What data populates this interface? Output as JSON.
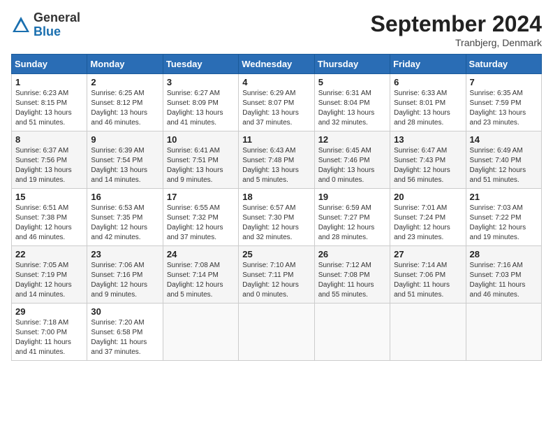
{
  "header": {
    "logo_general": "General",
    "logo_blue": "Blue",
    "title": "September 2024",
    "location": "Tranbjerg, Denmark"
  },
  "days_of_week": [
    "Sunday",
    "Monday",
    "Tuesday",
    "Wednesday",
    "Thursday",
    "Friday",
    "Saturday"
  ],
  "weeks": [
    [
      {
        "day": "1",
        "info": "Sunrise: 6:23 AM\nSunset: 8:15 PM\nDaylight: 13 hours\nand 51 minutes."
      },
      {
        "day": "2",
        "info": "Sunrise: 6:25 AM\nSunset: 8:12 PM\nDaylight: 13 hours\nand 46 minutes."
      },
      {
        "day": "3",
        "info": "Sunrise: 6:27 AM\nSunset: 8:09 PM\nDaylight: 13 hours\nand 41 minutes."
      },
      {
        "day": "4",
        "info": "Sunrise: 6:29 AM\nSunset: 8:07 PM\nDaylight: 13 hours\nand 37 minutes."
      },
      {
        "day": "5",
        "info": "Sunrise: 6:31 AM\nSunset: 8:04 PM\nDaylight: 13 hours\nand 32 minutes."
      },
      {
        "day": "6",
        "info": "Sunrise: 6:33 AM\nSunset: 8:01 PM\nDaylight: 13 hours\nand 28 minutes."
      },
      {
        "day": "7",
        "info": "Sunrise: 6:35 AM\nSunset: 7:59 PM\nDaylight: 13 hours\nand 23 minutes."
      }
    ],
    [
      {
        "day": "8",
        "info": "Sunrise: 6:37 AM\nSunset: 7:56 PM\nDaylight: 13 hours\nand 19 minutes."
      },
      {
        "day": "9",
        "info": "Sunrise: 6:39 AM\nSunset: 7:54 PM\nDaylight: 13 hours\nand 14 minutes."
      },
      {
        "day": "10",
        "info": "Sunrise: 6:41 AM\nSunset: 7:51 PM\nDaylight: 13 hours\nand 9 minutes."
      },
      {
        "day": "11",
        "info": "Sunrise: 6:43 AM\nSunset: 7:48 PM\nDaylight: 13 hours\nand 5 minutes."
      },
      {
        "day": "12",
        "info": "Sunrise: 6:45 AM\nSunset: 7:46 PM\nDaylight: 13 hours\nand 0 minutes."
      },
      {
        "day": "13",
        "info": "Sunrise: 6:47 AM\nSunset: 7:43 PM\nDaylight: 12 hours\nand 56 minutes."
      },
      {
        "day": "14",
        "info": "Sunrise: 6:49 AM\nSunset: 7:40 PM\nDaylight: 12 hours\nand 51 minutes."
      }
    ],
    [
      {
        "day": "15",
        "info": "Sunrise: 6:51 AM\nSunset: 7:38 PM\nDaylight: 12 hours\nand 46 minutes."
      },
      {
        "day": "16",
        "info": "Sunrise: 6:53 AM\nSunset: 7:35 PM\nDaylight: 12 hours\nand 42 minutes."
      },
      {
        "day": "17",
        "info": "Sunrise: 6:55 AM\nSunset: 7:32 PM\nDaylight: 12 hours\nand 37 minutes."
      },
      {
        "day": "18",
        "info": "Sunrise: 6:57 AM\nSunset: 7:30 PM\nDaylight: 12 hours\nand 32 minutes."
      },
      {
        "day": "19",
        "info": "Sunrise: 6:59 AM\nSunset: 7:27 PM\nDaylight: 12 hours\nand 28 minutes."
      },
      {
        "day": "20",
        "info": "Sunrise: 7:01 AM\nSunset: 7:24 PM\nDaylight: 12 hours\nand 23 minutes."
      },
      {
        "day": "21",
        "info": "Sunrise: 7:03 AM\nSunset: 7:22 PM\nDaylight: 12 hours\nand 19 minutes."
      }
    ],
    [
      {
        "day": "22",
        "info": "Sunrise: 7:05 AM\nSunset: 7:19 PM\nDaylight: 12 hours\nand 14 minutes."
      },
      {
        "day": "23",
        "info": "Sunrise: 7:06 AM\nSunset: 7:16 PM\nDaylight: 12 hours\nand 9 minutes."
      },
      {
        "day": "24",
        "info": "Sunrise: 7:08 AM\nSunset: 7:14 PM\nDaylight: 12 hours\nand 5 minutes."
      },
      {
        "day": "25",
        "info": "Sunrise: 7:10 AM\nSunset: 7:11 PM\nDaylight: 12 hours\nand 0 minutes."
      },
      {
        "day": "26",
        "info": "Sunrise: 7:12 AM\nSunset: 7:08 PM\nDaylight: 11 hours\nand 55 minutes."
      },
      {
        "day": "27",
        "info": "Sunrise: 7:14 AM\nSunset: 7:06 PM\nDaylight: 11 hours\nand 51 minutes."
      },
      {
        "day": "28",
        "info": "Sunrise: 7:16 AM\nSunset: 7:03 PM\nDaylight: 11 hours\nand 46 minutes."
      }
    ],
    [
      {
        "day": "29",
        "info": "Sunrise: 7:18 AM\nSunset: 7:00 PM\nDaylight: 11 hours\nand 41 minutes."
      },
      {
        "day": "30",
        "info": "Sunrise: 7:20 AM\nSunset: 6:58 PM\nDaylight: 11 hours\nand 37 minutes."
      },
      {
        "day": "",
        "info": ""
      },
      {
        "day": "",
        "info": ""
      },
      {
        "day": "",
        "info": ""
      },
      {
        "day": "",
        "info": ""
      },
      {
        "day": "",
        "info": ""
      }
    ]
  ]
}
